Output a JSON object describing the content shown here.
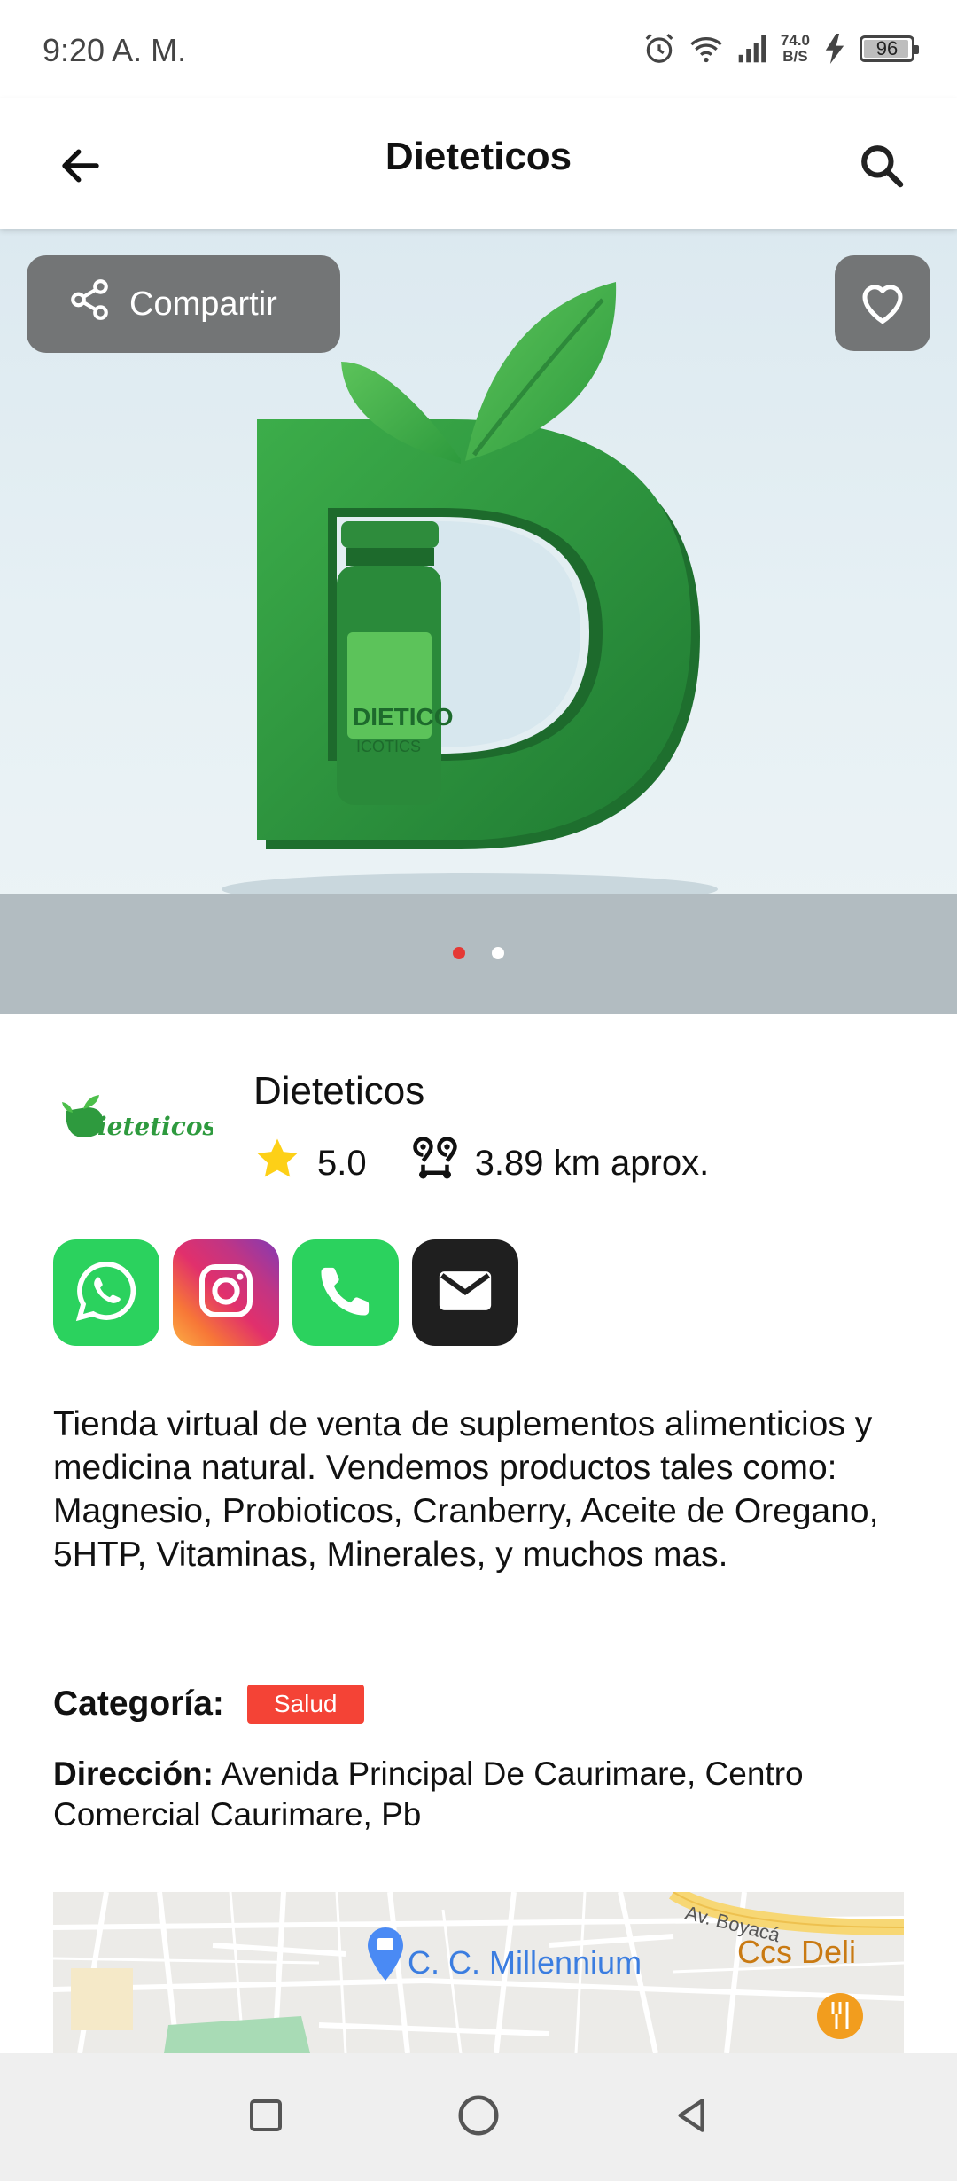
{
  "status": {
    "time": "9:20 A. M.",
    "net_speed_top": "74.0",
    "net_speed_bottom": "B/S",
    "battery": "96",
    "battery_level": 0.96
  },
  "app_bar": {
    "title": "Dieteticos",
    "back_icon": "arrow-left-icon",
    "search_icon": "search-icon"
  },
  "hero": {
    "share_label": "Compartir",
    "favorite_icon": "heart-outline-icon",
    "slides_count": 2,
    "active_slide": 1,
    "image_text_line1": "DIETICO",
    "image_text_line2": "ICOTICS"
  },
  "business": {
    "name": "Dieteticos",
    "logo_text": "ieteticos",
    "rating": "5.0",
    "distance": "3.89 km aprox.",
    "description": "Tienda virtual de venta de suplementos alimenticios y medicina natural. Vendemos productos tales como: Magnesio, Probioticos, Cranberry, Aceite de Oregano, 5HTP, Vitaminas, Minerales, y muchos mas.",
    "category_label": "Categoría:",
    "category": "Salud",
    "address_label": "Dirección:",
    "address": "Avenida Principal De Caurimare, Centro Comercial Caurimare, Pb"
  },
  "contacts": [
    {
      "type": "whatsapp",
      "icon": "whatsapp-icon",
      "color": "#2bd25e"
    },
    {
      "type": "instagram",
      "icon": "instagram-icon",
      "color": "#e1306c"
    },
    {
      "type": "phone",
      "icon": "phone-icon",
      "color": "#2bd25e"
    },
    {
      "type": "email",
      "icon": "mail-icon",
      "color": "#1f1f1f"
    }
  ],
  "map": {
    "label_millennium": "C. C. Millennium",
    "label_deli": "Ccs Deli",
    "label_street": "Av. Boyacá"
  },
  "colors": {
    "accent_red": "#f44336",
    "brand_green": "#2e9a3e",
    "star": "#fdd017"
  }
}
